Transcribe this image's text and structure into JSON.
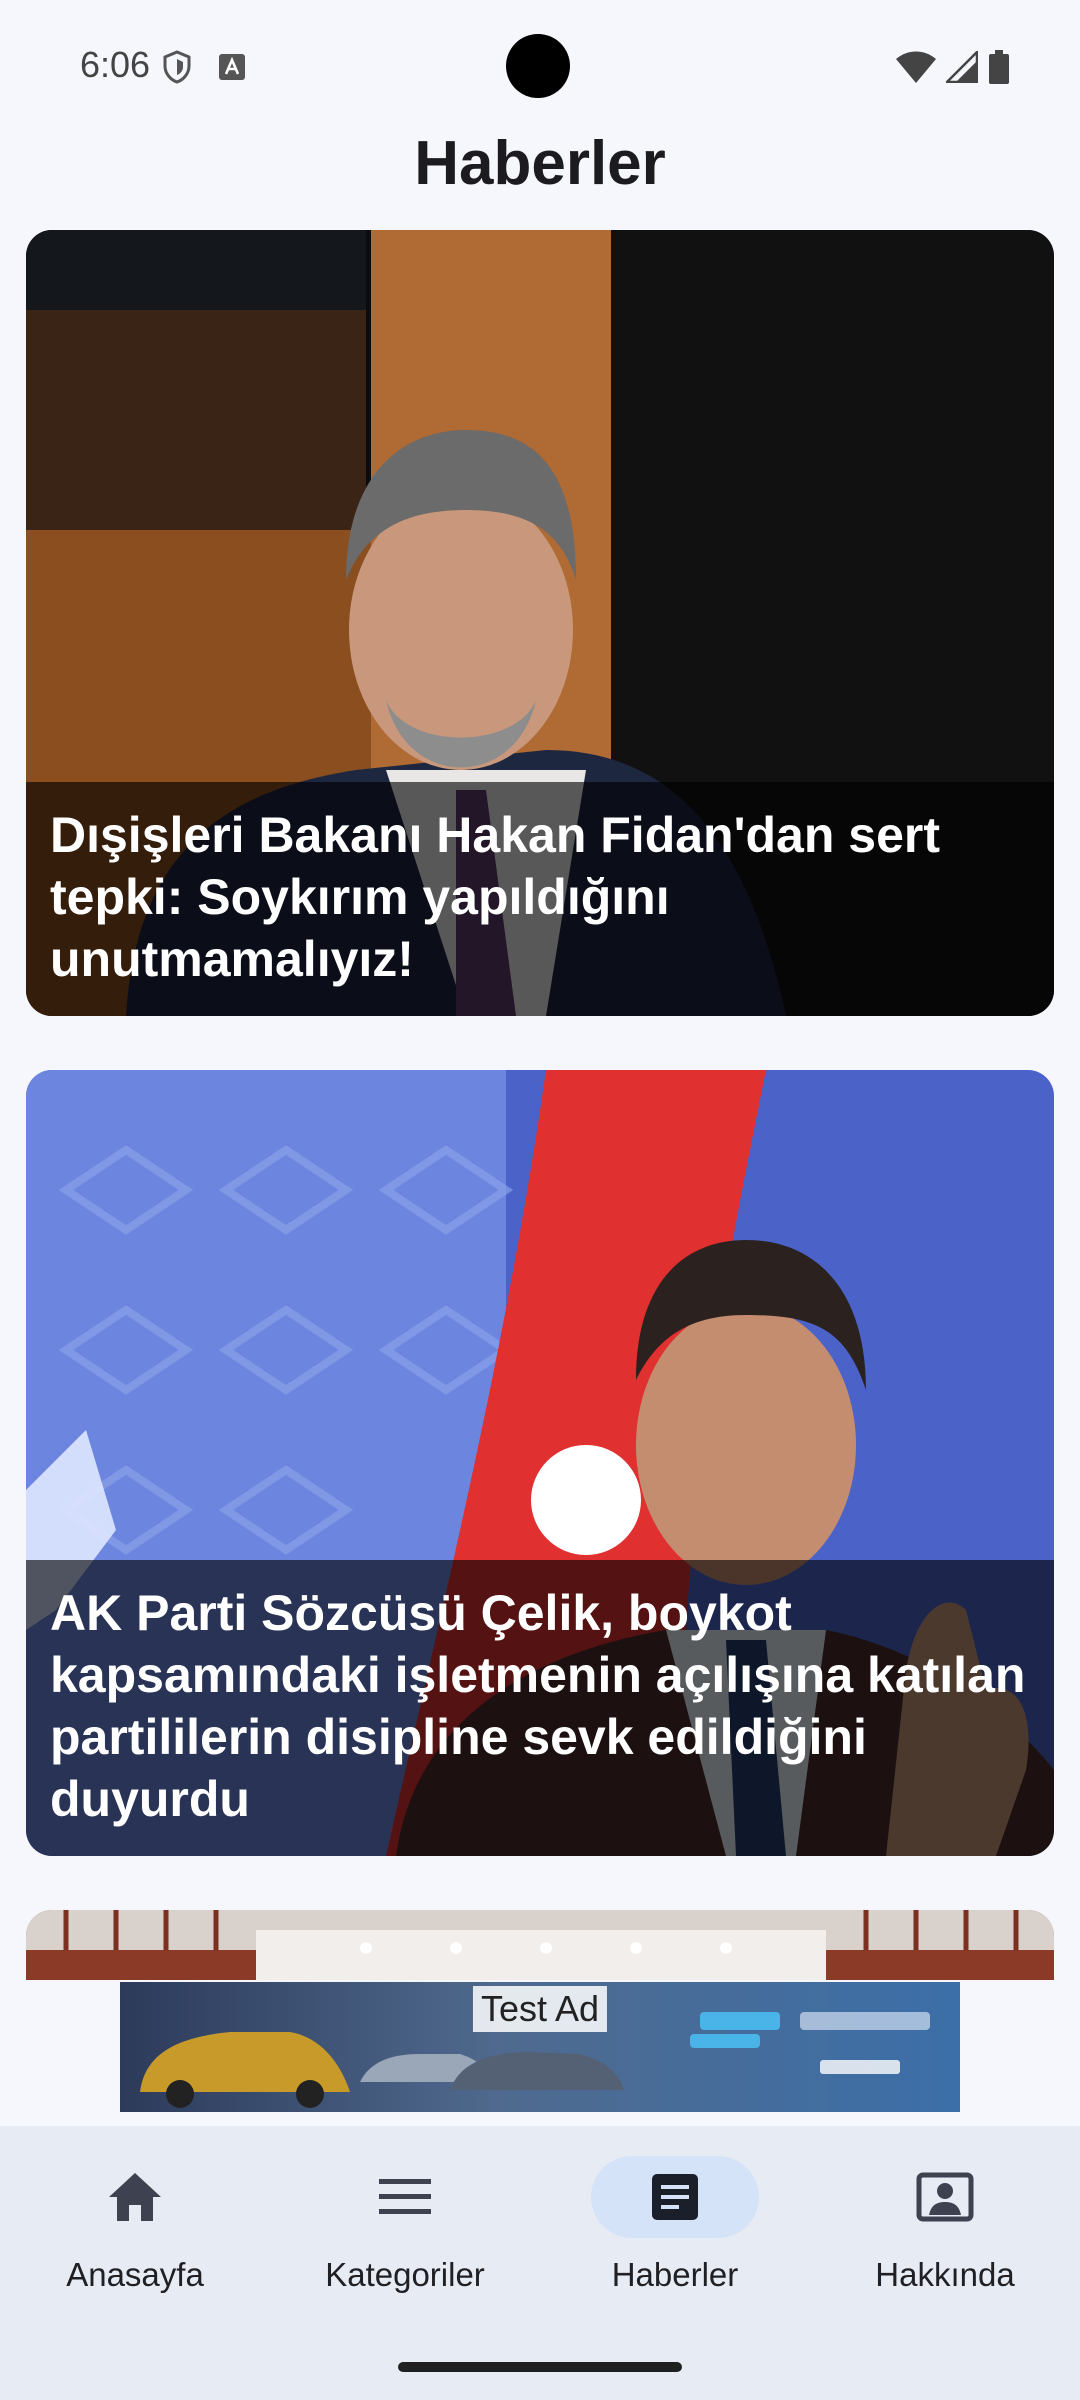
{
  "status_bar": {
    "time": "6:06",
    "left_icons": [
      "shield-icon",
      "font-download-icon"
    ],
    "right_icons": [
      "wifi-icon",
      "signal-icon",
      "battery-icon"
    ]
  },
  "header": {
    "title": "Haberler"
  },
  "news": [
    {
      "title": "Dışişleri Bakanı Hakan Fidan'dan sert tepki: Soykırım yapıldığını unutmamalıyız!"
    },
    {
      "title": "AK Parti Sözcüsü Çelik, boykot kapsamındaki işletmenin açılışına katılan partililerin disipline sevk edildiğini duyurdu"
    },
    {
      "title": ""
    }
  ],
  "ad": {
    "label": "Test Ad"
  },
  "bottom_nav": {
    "active_index": 2,
    "items": [
      {
        "label": "Anasayfa",
        "icon": "home-icon"
      },
      {
        "label": "Kategoriler",
        "icon": "menu-icon"
      },
      {
        "label": "Haberler",
        "icon": "article-icon"
      },
      {
        "label": "Hakkında",
        "icon": "contact-page-icon"
      }
    ]
  },
  "colors": {
    "background": "#f6f7fc",
    "nav_background": "#e7ebf3",
    "nav_active_pill": "#d4e3f7",
    "caption_overlay": "rgba(0,0,0,0.62)"
  }
}
